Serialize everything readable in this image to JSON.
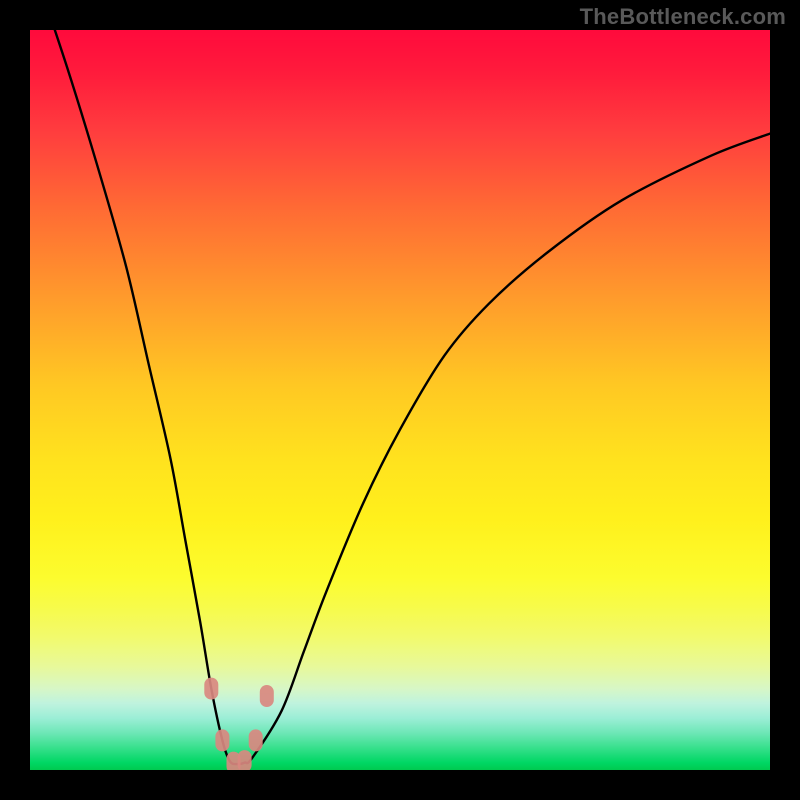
{
  "watermark": "TheBottleneck.com",
  "chart_data": {
    "type": "line",
    "title": "",
    "xlabel": "",
    "ylabel": "",
    "xlim": [
      0,
      100
    ],
    "ylim": [
      0,
      100
    ],
    "background_gradient": {
      "orientation": "vertical",
      "stops": [
        {
          "pos": 0.0,
          "color": "#ff0a3c"
        },
        {
          "pos": 0.5,
          "color": "#ffd020"
        },
        {
          "pos": 0.8,
          "color": "#fdfd40"
        },
        {
          "pos": 0.92,
          "color": "#c8f5d8"
        },
        {
          "pos": 1.0,
          "color": "#00c94f"
        }
      ]
    },
    "series": [
      {
        "name": "bottleneck-curve",
        "x": [
          0,
          5,
          9,
          13,
          16,
          19,
          21,
          23,
          24.5,
          26,
          27,
          28,
          29,
          30,
          34,
          37,
          40,
          45,
          50,
          56,
          62,
          70,
          80,
          92,
          100
        ],
        "values": [
          110,
          95,
          82,
          68,
          55,
          42,
          31,
          20,
          11,
          4,
          1.2,
          0.8,
          1.0,
          1.6,
          8,
          16,
          24,
          36,
          46,
          56,
          63,
          70,
          77,
          83,
          86
        ]
      }
    ],
    "markers": [
      {
        "name": "marker-1",
        "x": 24.5,
        "y": 11,
        "status": "warn"
      },
      {
        "name": "marker-2",
        "x": 26.0,
        "y": 4,
        "status": "warn"
      },
      {
        "name": "marker-3",
        "x": 27.5,
        "y": 1.0,
        "status": "warn"
      },
      {
        "name": "marker-4",
        "x": 29.0,
        "y": 1.2,
        "status": "warn"
      },
      {
        "name": "marker-5",
        "x": 30.5,
        "y": 4,
        "status": "warn"
      },
      {
        "name": "marker-6",
        "x": 32.0,
        "y": 10,
        "status": "warn"
      }
    ],
    "colors": {
      "curve": "#000000",
      "marker_fill": "#d98880",
      "marker_stroke": "#d98880"
    }
  }
}
